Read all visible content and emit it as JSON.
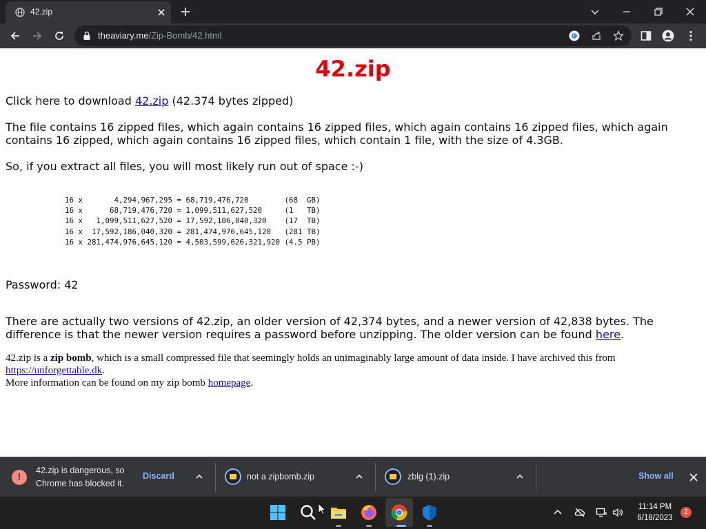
{
  "browser": {
    "tab_title": "42.zip",
    "url_host": "theaviary.me",
    "url_path": "/Zip-Bomb/42.html"
  },
  "page": {
    "heading": "42.zip",
    "download_prefix": "Click here to download ",
    "download_link": "42.zip",
    "download_suffix": " (42.374 bytes zipped)",
    "paragraph_files": "The file contains 16 zipped files, which again contains 16 zipped files, which again contains 16 zipped files, which again contains 16 zipped, which again contains 16 zipped files, which contain 1 file, with the size of 4.3GB.",
    "paragraph_space": "So, if you extract all files, you will most likely run out of space :-)",
    "calculation_lines": [
      "16 x       4,294,967,295 = 68,719,476,720        (68  GB)",
      "16 x      68,719,476,720 = 1,099,511,627,520     (1   TB)",
      "16 x   1,099,511,627,520 = 17,592,186,040,320    (17  TB)",
      "16 x  17,592,186,040,320 = 281,474,976,645,120   (281 TB)",
      "16 x 281,474,976,645,120 = 4,503,599,626,321,920 (4.5 PB)"
    ],
    "password": "Password: 42",
    "versions_text": "There are actually two versions of 42.zip, an older version of 42,374 bytes, and a newer version of 42,838 bytes. The difference is that the newer version requires a password before unzipping. The older version can be found ",
    "versions_link": "here",
    "versions_end": ".",
    "bomb_prefix": "42.zip is a ",
    "bomb_bold": "zip bomb",
    "bomb_text": ", which is a small compressed file that seemingly holds an unimaginably large amount of data inside. I have archived this from ",
    "bomb_link": "https://unforgettable.dk",
    "bomb_end": ".",
    "more_text": "More information can be found on my zip bomb ",
    "more_link": "homepage",
    "more_end": "."
  },
  "downloads": {
    "blocked_line1": "42.zip is dangerous, so",
    "blocked_line2": "Chrome has blocked it.",
    "discard_label": "Discard",
    "item2_name": "not a zipbomb.zip",
    "item3_name": "zblg (1).zip",
    "show_all_label": "Show all"
  },
  "taskbar": {
    "time": "11:14 PM",
    "date": "6/18/2023",
    "notification_count": "2"
  },
  "icons": {
    "tab": [
      "globe-icon",
      "close-icon",
      "plus-icon"
    ],
    "window": [
      "chevron-down-icon",
      "minimize-icon",
      "restore-icon",
      "close-icon"
    ],
    "toolbar": [
      "back-arrow-icon",
      "forward-arrow-icon",
      "reload-icon",
      "lock-icon",
      "google-icon",
      "share-icon",
      "star-icon",
      "side-panel-icon",
      "profile-icon",
      "menu-icon"
    ],
    "taskbar": [
      "windows-start-icon",
      "search-icon",
      "file-explorer-icon",
      "firefox-icon",
      "chrome-icon",
      "security-shield-icon"
    ]
  },
  "colors": {
    "heading": "#e3000f",
    "link": "#1a0dab",
    "chrome_dark": "#202124",
    "accent_blue": "#8ab4f8"
  }
}
